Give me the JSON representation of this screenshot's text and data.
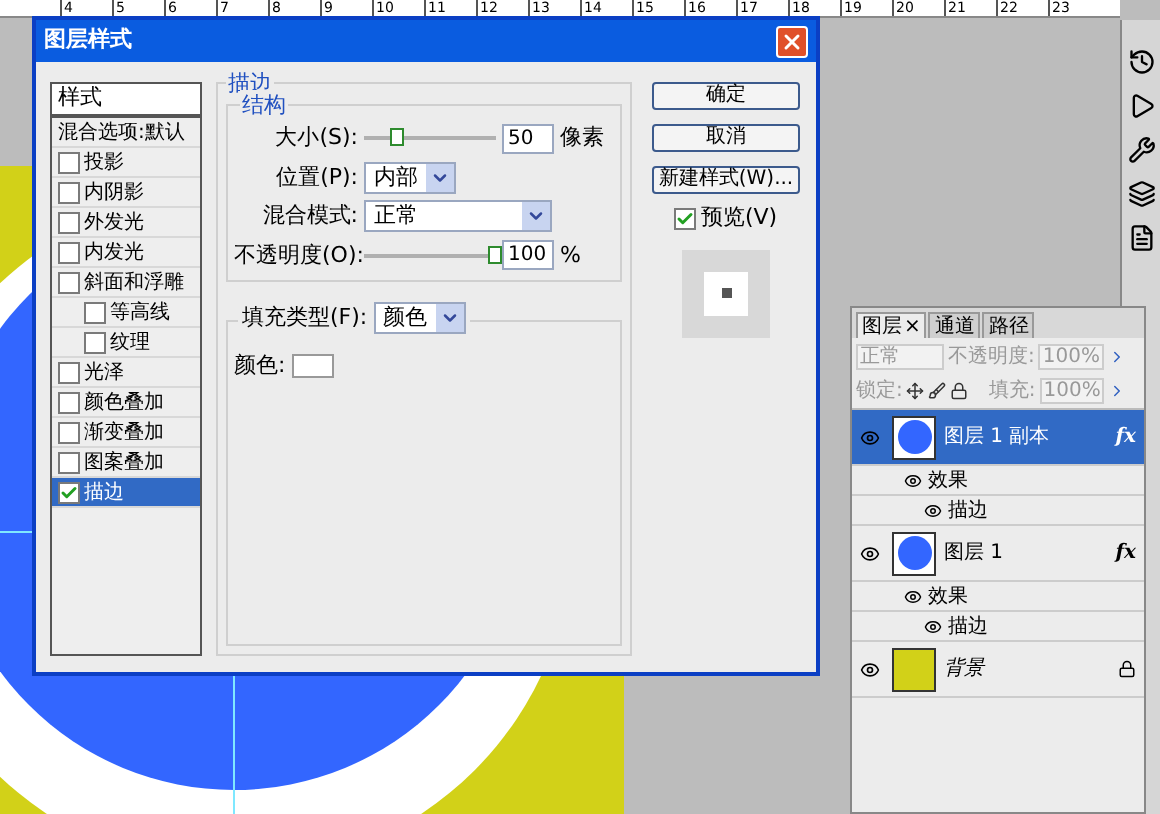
{
  "ruler": {
    "numbers": [
      "4",
      "5",
      "6",
      "7",
      "8",
      "9",
      "10",
      "11",
      "12",
      "13",
      "14",
      "15",
      "16",
      "17",
      "18",
      "19",
      "20",
      "21",
      "22",
      "23"
    ]
  },
  "dialog": {
    "title": "图层样式",
    "styles_list": {
      "header": "样式",
      "items": [
        {
          "label": "混合选项:默认",
          "kind": "plain",
          "selected": false
        },
        {
          "label": "投影",
          "kind": "checkbox",
          "checked": false,
          "selected": false
        },
        {
          "label": "内阴影",
          "kind": "checkbox",
          "checked": false,
          "selected": false
        },
        {
          "label": "外发光",
          "kind": "checkbox",
          "checked": false,
          "selected": false
        },
        {
          "label": "内发光",
          "kind": "checkbox",
          "checked": false,
          "selected": false
        },
        {
          "label": "斜面和浮雕",
          "kind": "checkbox",
          "checked": false,
          "selected": false,
          "children": [
            {
              "label": "等高线",
              "kind": "checkbox",
              "checked": false,
              "selected": false
            },
            {
              "label": "纹理",
              "kind": "checkbox",
              "checked": false,
              "selected": false
            }
          ]
        },
        {
          "label": "光泽",
          "kind": "checkbox",
          "checked": false,
          "selected": false
        },
        {
          "label": "颜色叠加",
          "kind": "checkbox",
          "checked": false,
          "selected": false
        },
        {
          "label": "渐变叠加",
          "kind": "checkbox",
          "checked": false,
          "selected": false
        },
        {
          "label": "图案叠加",
          "kind": "checkbox",
          "checked": false,
          "selected": false
        },
        {
          "label": "描边",
          "kind": "checkbox",
          "checked": true,
          "selected": true
        }
      ]
    },
    "stroke": {
      "title": "描边",
      "structure": {
        "title": "结构",
        "size": {
          "label": "大小(S):",
          "level": 0.25,
          "value": "50",
          "unit": "像素"
        },
        "position": {
          "label": "位置(P):",
          "value": "内部"
        },
        "blend_mode": {
          "label": "混合模式:",
          "value": "正常"
        },
        "opacity": {
          "label": "不透明度(O):",
          "level": 1,
          "value": "100",
          "unit": "%"
        }
      },
      "fill": {
        "type_label": "填充类型(F):",
        "type_value": "颜色",
        "color_label": "颜色:",
        "color": "#ffffff"
      }
    },
    "buttons": [
      "确定",
      "取消",
      "新建样式(W)..."
    ],
    "preview": {
      "label": "预览(V)",
      "checked": true
    }
  },
  "layers_panel": {
    "tabs": [
      {
        "label": "图层",
        "selected": true,
        "close": "×"
      },
      {
        "label": "通道",
        "selected": false
      },
      {
        "label": "路径",
        "selected": false
      }
    ],
    "blend_mode": "正常",
    "opacity_label": "不透明度:",
    "opacity": "100%",
    "lock_label": "锁定:",
    "fill_label": "填充:",
    "fill": "100%",
    "layers": [
      {
        "name": "图层 1 副本",
        "selected": true,
        "visible": true,
        "kind": "circle",
        "color": "#3366ff",
        "fx": "fx",
        "effects": {
          "label": "效果",
          "items": [
            "描边"
          ]
        }
      },
      {
        "name": "图层 1",
        "selected": false,
        "visible": true,
        "kind": "circle",
        "color": "#3366ff",
        "fx": "fx",
        "effects": {
          "label": "效果",
          "items": [
            "描边"
          ]
        }
      },
      {
        "name": "背景",
        "selected": false,
        "visible": true,
        "kind": "fill",
        "color": "#d2d118",
        "locked": true,
        "italic": true
      }
    ]
  }
}
